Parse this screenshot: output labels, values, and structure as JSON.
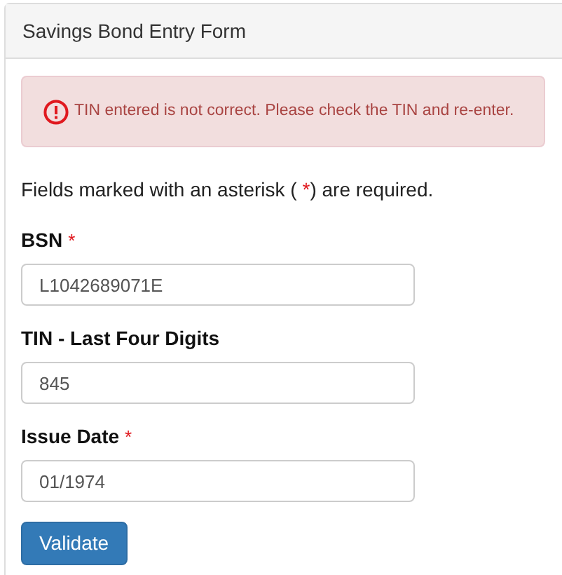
{
  "panel": {
    "title": "Savings Bond Entry Form"
  },
  "alert": {
    "message": "TIN entered is not correct. Please check the TIN and re-enter."
  },
  "note": {
    "before": "Fields marked with an asterisk ( ",
    "mark": "*",
    "after": ") are required."
  },
  "fields": [
    {
      "label": "BSN",
      "required_mark": "*",
      "value": "L1042689071E"
    },
    {
      "label": "TIN - Last Four Digits",
      "value": "845"
    },
    {
      "label": "Issue Date",
      "required_mark": "*",
      "value": "01/1974"
    }
  ],
  "button": "Validate"
}
